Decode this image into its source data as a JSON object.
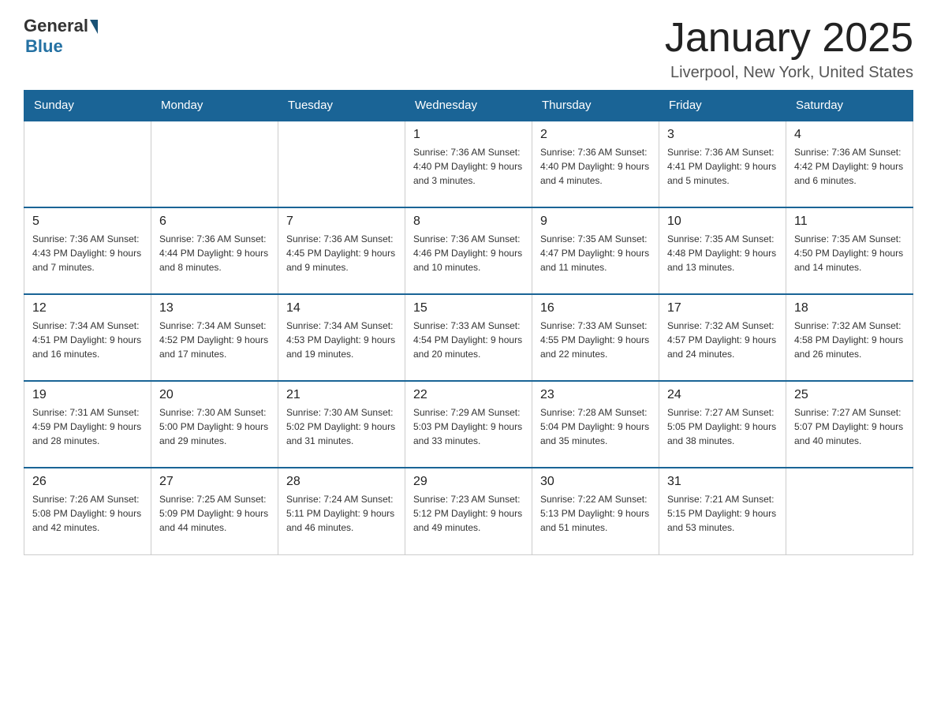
{
  "logo": {
    "general": "General",
    "blue": "Blue"
  },
  "title": "January 2025",
  "subtitle": "Liverpool, New York, United States",
  "days": [
    "Sunday",
    "Monday",
    "Tuesday",
    "Wednesday",
    "Thursday",
    "Friday",
    "Saturday"
  ],
  "weeks": [
    [
      {
        "day": "",
        "info": ""
      },
      {
        "day": "",
        "info": ""
      },
      {
        "day": "",
        "info": ""
      },
      {
        "day": "1",
        "info": "Sunrise: 7:36 AM\nSunset: 4:40 PM\nDaylight: 9 hours and 3 minutes."
      },
      {
        "day": "2",
        "info": "Sunrise: 7:36 AM\nSunset: 4:40 PM\nDaylight: 9 hours and 4 minutes."
      },
      {
        "day": "3",
        "info": "Sunrise: 7:36 AM\nSunset: 4:41 PM\nDaylight: 9 hours and 5 minutes."
      },
      {
        "day": "4",
        "info": "Sunrise: 7:36 AM\nSunset: 4:42 PM\nDaylight: 9 hours and 6 minutes."
      }
    ],
    [
      {
        "day": "5",
        "info": "Sunrise: 7:36 AM\nSunset: 4:43 PM\nDaylight: 9 hours and 7 minutes."
      },
      {
        "day": "6",
        "info": "Sunrise: 7:36 AM\nSunset: 4:44 PM\nDaylight: 9 hours and 8 minutes."
      },
      {
        "day": "7",
        "info": "Sunrise: 7:36 AM\nSunset: 4:45 PM\nDaylight: 9 hours and 9 minutes."
      },
      {
        "day": "8",
        "info": "Sunrise: 7:36 AM\nSunset: 4:46 PM\nDaylight: 9 hours and 10 minutes."
      },
      {
        "day": "9",
        "info": "Sunrise: 7:35 AM\nSunset: 4:47 PM\nDaylight: 9 hours and 11 minutes."
      },
      {
        "day": "10",
        "info": "Sunrise: 7:35 AM\nSunset: 4:48 PM\nDaylight: 9 hours and 13 minutes."
      },
      {
        "day": "11",
        "info": "Sunrise: 7:35 AM\nSunset: 4:50 PM\nDaylight: 9 hours and 14 minutes."
      }
    ],
    [
      {
        "day": "12",
        "info": "Sunrise: 7:34 AM\nSunset: 4:51 PM\nDaylight: 9 hours and 16 minutes."
      },
      {
        "day": "13",
        "info": "Sunrise: 7:34 AM\nSunset: 4:52 PM\nDaylight: 9 hours and 17 minutes."
      },
      {
        "day": "14",
        "info": "Sunrise: 7:34 AM\nSunset: 4:53 PM\nDaylight: 9 hours and 19 minutes."
      },
      {
        "day": "15",
        "info": "Sunrise: 7:33 AM\nSunset: 4:54 PM\nDaylight: 9 hours and 20 minutes."
      },
      {
        "day": "16",
        "info": "Sunrise: 7:33 AM\nSunset: 4:55 PM\nDaylight: 9 hours and 22 minutes."
      },
      {
        "day": "17",
        "info": "Sunrise: 7:32 AM\nSunset: 4:57 PM\nDaylight: 9 hours and 24 minutes."
      },
      {
        "day": "18",
        "info": "Sunrise: 7:32 AM\nSunset: 4:58 PM\nDaylight: 9 hours and 26 minutes."
      }
    ],
    [
      {
        "day": "19",
        "info": "Sunrise: 7:31 AM\nSunset: 4:59 PM\nDaylight: 9 hours and 28 minutes."
      },
      {
        "day": "20",
        "info": "Sunrise: 7:30 AM\nSunset: 5:00 PM\nDaylight: 9 hours and 29 minutes."
      },
      {
        "day": "21",
        "info": "Sunrise: 7:30 AM\nSunset: 5:02 PM\nDaylight: 9 hours and 31 minutes."
      },
      {
        "day": "22",
        "info": "Sunrise: 7:29 AM\nSunset: 5:03 PM\nDaylight: 9 hours and 33 minutes."
      },
      {
        "day": "23",
        "info": "Sunrise: 7:28 AM\nSunset: 5:04 PM\nDaylight: 9 hours and 35 minutes."
      },
      {
        "day": "24",
        "info": "Sunrise: 7:27 AM\nSunset: 5:05 PM\nDaylight: 9 hours and 38 minutes."
      },
      {
        "day": "25",
        "info": "Sunrise: 7:27 AM\nSunset: 5:07 PM\nDaylight: 9 hours and 40 minutes."
      }
    ],
    [
      {
        "day": "26",
        "info": "Sunrise: 7:26 AM\nSunset: 5:08 PM\nDaylight: 9 hours and 42 minutes."
      },
      {
        "day": "27",
        "info": "Sunrise: 7:25 AM\nSunset: 5:09 PM\nDaylight: 9 hours and 44 minutes."
      },
      {
        "day": "28",
        "info": "Sunrise: 7:24 AM\nSunset: 5:11 PM\nDaylight: 9 hours and 46 minutes."
      },
      {
        "day": "29",
        "info": "Sunrise: 7:23 AM\nSunset: 5:12 PM\nDaylight: 9 hours and 49 minutes."
      },
      {
        "day": "30",
        "info": "Sunrise: 7:22 AM\nSunset: 5:13 PM\nDaylight: 9 hours and 51 minutes."
      },
      {
        "day": "31",
        "info": "Sunrise: 7:21 AM\nSunset: 5:15 PM\nDaylight: 9 hours and 53 minutes."
      },
      {
        "day": "",
        "info": ""
      }
    ]
  ]
}
